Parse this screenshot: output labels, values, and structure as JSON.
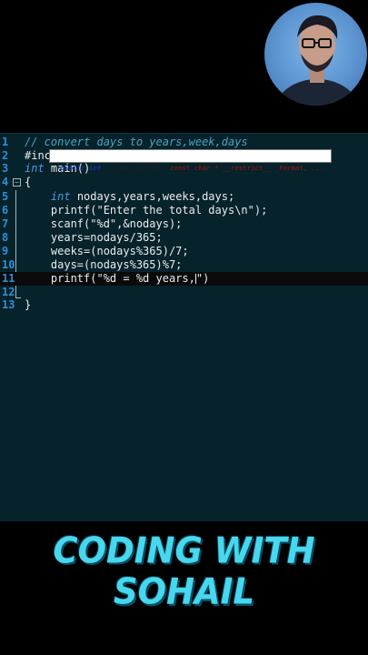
{
  "editor": {
    "lines": [
      {
        "n": "1",
        "segments": [
          {
            "t": "// convert days to years,week,days",
            "c": "cmt"
          }
        ]
      },
      {
        "n": "2",
        "segments": [
          {
            "t": "#include<stdio.h>",
            "c": ""
          }
        ]
      },
      {
        "n": "3",
        "segments": [
          {
            "t": "int",
            "c": "kw"
          },
          {
            "t": " main()",
            "c": ""
          }
        ]
      },
      {
        "n": "4",
        "segments": [
          {
            "t": "{",
            "c": ""
          }
        ]
      },
      {
        "n": "5",
        "segments": [
          {
            "t": "    ",
            "c": ""
          },
          {
            "t": "int",
            "c": "kw"
          },
          {
            "t": " nodays,years,weeks,days;",
            "c": ""
          }
        ]
      },
      {
        "n": "6",
        "segments": [
          {
            "t": "    printf(\"Enter the total days\\n\");",
            "c": ""
          }
        ]
      },
      {
        "n": "7",
        "segments": [
          {
            "t": "    scanf(\"%d\",&nodays);",
            "c": ""
          }
        ]
      },
      {
        "n": "8",
        "segments": [
          {
            "t": "    years=nodays/365;",
            "c": ""
          }
        ]
      },
      {
        "n": "9",
        "segments": [
          {
            "t": "    weeks=(nodays%365)/7;",
            "c": ""
          }
        ]
      },
      {
        "n": "10",
        "segments": [
          {
            "t": "    days=(nodays%365)%7;",
            "c": ""
          }
        ]
      },
      {
        "n": "11",
        "segments": [
          {
            "t": "    printf(\"%d = %d years,",
            "c": ""
          },
          {
            "t": "\")",
            "c": "after"
          }
        ]
      },
      {
        "n": "12",
        "segments": []
      },
      {
        "n": "13",
        "segments": [
          {
            "t": "}",
            "c": ""
          }
        ]
      }
    ]
  },
  "tooltip": {
    "kw": "public int",
    "mid": " __cdecl printf (",
    "params": "const char * __restrict__ _Format, ...",
    "end": ")"
  },
  "banner": "CODING WITH SOHAIL",
  "avatar": {
    "icon": "presenter-avatar"
  }
}
